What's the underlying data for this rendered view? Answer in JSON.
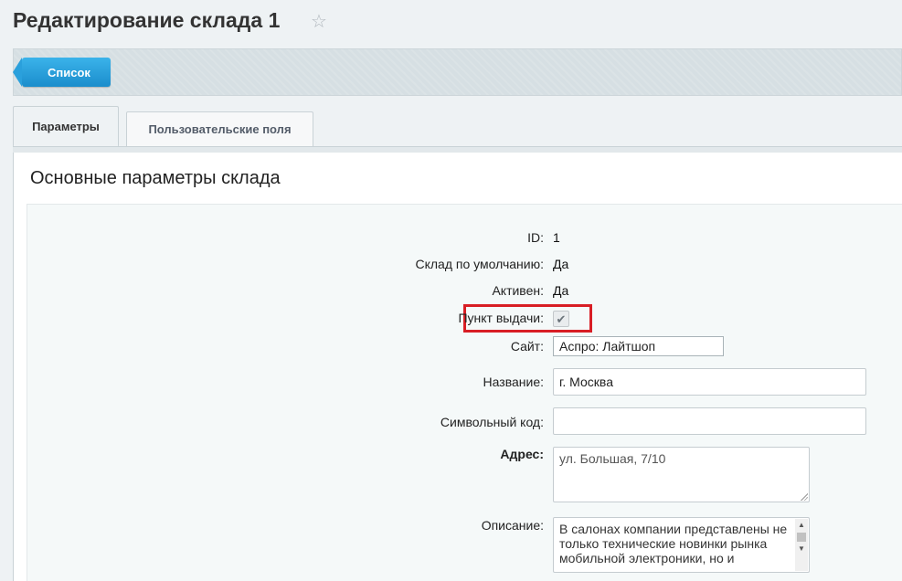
{
  "header": {
    "title": "Редактирование склада 1",
    "favorite_icon": "star-icon"
  },
  "toolbar": {
    "back_label": "Список"
  },
  "tabs": [
    {
      "label": "Параметры",
      "active": true
    },
    {
      "label": "Пользовательские поля",
      "active": false
    }
  ],
  "section": {
    "title": "Основные параметры склада"
  },
  "form": {
    "id": {
      "label": "ID:",
      "value": "1"
    },
    "default": {
      "label": "Склад по умолчанию:",
      "value": "Да"
    },
    "active": {
      "label": "Активен:",
      "value": "Да"
    },
    "pickup": {
      "label": "Пункт выдачи:",
      "checked": true
    },
    "site": {
      "label": "Сайт:",
      "value": "Аспро: Лайтшоп"
    },
    "name": {
      "label": "Название:",
      "value": "г. Москва"
    },
    "code": {
      "label": "Символьный код:",
      "value": ""
    },
    "address": {
      "label": "Адрес:",
      "value": "ул. Большая, 7/10"
    },
    "description": {
      "label": "Описание:",
      "value": "В салонах компании представлены не только технические новинки рынка мобильной электроники, но и"
    }
  },
  "colors": {
    "highlight": "#d81e25",
    "button": "#1b8dcc"
  }
}
